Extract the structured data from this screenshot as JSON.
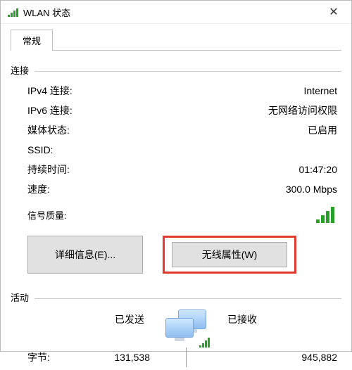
{
  "window": {
    "title": "WLAN 状态"
  },
  "tabs": {
    "general": "常规"
  },
  "section_connection": "连接",
  "rows": {
    "ipv4_label": "IPv4 连接:",
    "ipv4_value": "Internet",
    "ipv6_label": "IPv6 连接:",
    "ipv6_value": "无网络访问权限",
    "media_label": "媒体状态:",
    "media_value": "已启用",
    "ssid_label": "SSID:",
    "duration_label": "持续时间:",
    "duration_value": "01:47:20",
    "speed_label": "速度:",
    "speed_value": "300.0 Mbps",
    "signal_label": "信号质量:"
  },
  "buttons": {
    "details": "详细信息(E)...",
    "wireless_props": "无线属性(W)"
  },
  "section_activity": "活动",
  "activity": {
    "sent_label": "已发送",
    "received_label": "已接收",
    "bytes_label": "字节:",
    "bytes_sent": "131,538",
    "bytes_received": "945,882"
  }
}
